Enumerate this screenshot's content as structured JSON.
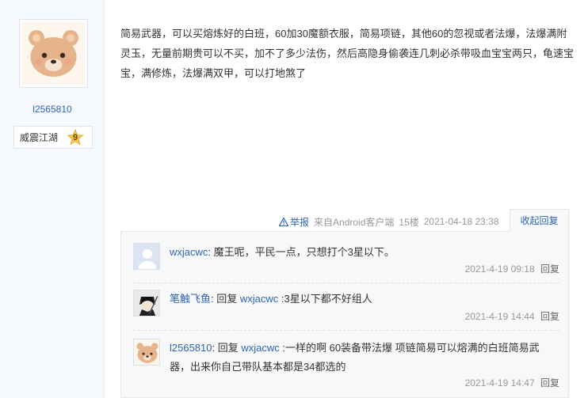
{
  "author": {
    "username": "l2565810",
    "rank_title": "威震江湖",
    "rank_level": "9",
    "avatar_icon": "bear-avatar-icon"
  },
  "post": {
    "content": "简易武器，可以买熔炼好的白班，60加30魔额衣服，简易项链，其他60的忽视或者法爆，法爆满附灵玉，无量前期贵可以不买，加不了多少法伤，然后高隐身偷袭连几刺必杀带吸血宝宝两只，龟速宝宝，满修炼，法爆满双甲，可以打地煞了",
    "report_label": "举报",
    "client": "来自Android客户端",
    "floor": "15楼",
    "timestamp": "2021-04-18 23:38",
    "collapse_label": "收起回复"
  },
  "replies": [
    {
      "author": "wxjacwc",
      "separator": ": ",
      "reply_prefix": "",
      "reply_to": "",
      "text": "魔王呢，平民一点，只想打个3星以下。",
      "time": "2021-4-19 09:18",
      "reply_label": "回复",
      "avatar_icon": "default-avatar-icon"
    },
    {
      "author": "笔触飞鱼",
      "separator": ": ",
      "reply_prefix": "回复 ",
      "reply_to": "wxjacwc",
      "text": " :3星以下都不好组人",
      "time": "2021-4-19 14:44",
      "reply_label": "回复",
      "avatar_icon": "dark-character-avatar-icon"
    },
    {
      "author": "l2565810",
      "separator": ": ",
      "reply_prefix": "回复 ",
      "reply_to": "wxjacwc",
      "text": " :一样的啊 60装备带法爆 项链简易可以熔满的白班简易武器，出来你自己带队基本都是34都选的",
      "time": "2021-4-19 14:47",
      "reply_label": "回复",
      "avatar_icon": "bear-avatar-icon"
    }
  ]
}
